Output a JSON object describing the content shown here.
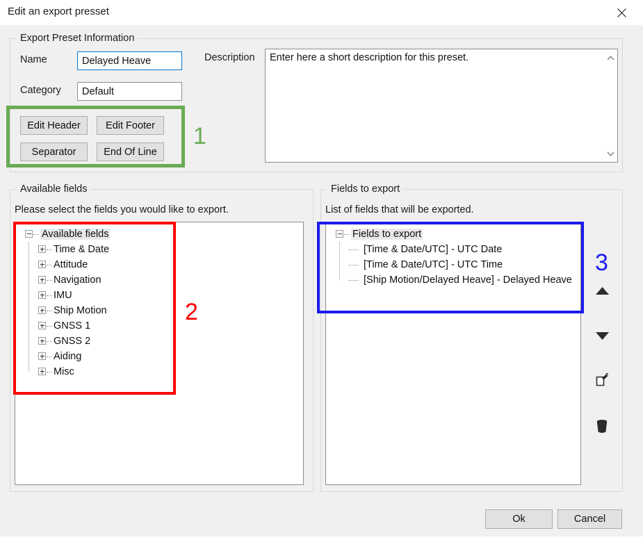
{
  "window": {
    "title": "Edit an export presset",
    "close_icon": "close-icon"
  },
  "preset_info": {
    "legend": "Export Preset Information",
    "name_label": "Name",
    "name_value": "Delayed Heave",
    "category_label": "Category",
    "category_value": "Default",
    "description_label": "Description",
    "description_value": "Enter here a short description for this preset.",
    "buttons": [
      {
        "label": "Edit Header",
        "name": "edit-header-button"
      },
      {
        "label": "Edit Footer",
        "name": "edit-footer-button"
      },
      {
        "label": "Separator",
        "name": "separator-button"
      },
      {
        "label": "End Of Line",
        "name": "end-of-line-button"
      }
    ],
    "scroll_up_icon": "chevron-up-icon",
    "scroll_down_icon": "chevron-down-icon"
  },
  "available_fields": {
    "legend": "Available fields",
    "instruction": "Please select the fields you would like to export.",
    "root_label": "Available fields",
    "items": [
      "Time & Date",
      "Attitude",
      "Navigation",
      "IMU",
      "Ship Motion",
      "GNSS 1",
      "GNSS 2",
      "Aiding",
      "Misc"
    ]
  },
  "fields_to_export": {
    "legend": "Fields to export",
    "instruction": "List of fields that will be exported.",
    "root_label": "Fields to export",
    "items": [
      "[Time & Date/UTC] - UTC Date",
      "[Time & Date/UTC] - UTC Time",
      "[Ship Motion/Delayed Heave] - Delayed Heave"
    ]
  },
  "side_actions": [
    {
      "name": "move-up-button",
      "icon": "triangle-up-icon"
    },
    {
      "name": "move-down-button",
      "icon": "triangle-down-icon"
    },
    {
      "name": "edit-field-button",
      "icon": "note-edit-icon"
    },
    {
      "name": "delete-field-button",
      "icon": "trash-icon"
    }
  ],
  "footer": {
    "ok_label": "Ok",
    "cancel_label": "Cancel"
  },
  "annotations": [
    {
      "number": "1",
      "color": "#6aab54"
    },
    {
      "number": "2",
      "color": "#ff0000"
    },
    {
      "number": "3",
      "color": "#1a1aee"
    }
  ]
}
